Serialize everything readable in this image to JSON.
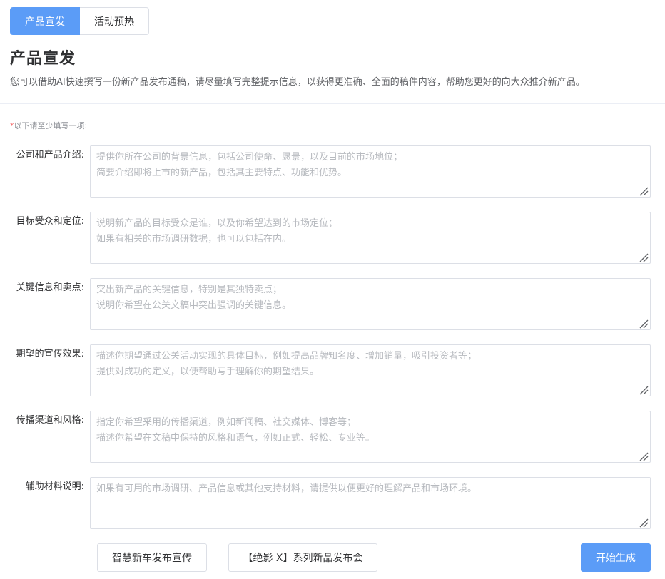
{
  "tabs": [
    {
      "label": "产品宣发",
      "active": true
    },
    {
      "label": "活动预热",
      "active": false
    }
  ],
  "header": {
    "title": "产品宣发",
    "description": "您可以借助AI快速撰写一份新产品发布通稿，请尽量填写完整提示信息，以获得更准确、全面的稿件内容，帮助您更好的向大众推介新产品。"
  },
  "form": {
    "required_mark": "*",
    "hint": "以下请至少填写一项:",
    "fields": [
      {
        "label": "公司和产品介绍:",
        "value": "",
        "placeholder": "提供你所在公司的背景信息，包括公司使命、愿景，以及目前的市场地位；\n简要介绍即将上市的新产品，包括其主要特点、功能和优势。"
      },
      {
        "label": "目标受众和定位:",
        "value": "",
        "placeholder": "说明新产品的目标受众是谁，以及你希望达到的市场定位；\n如果有相关的市场调研数据，也可以包括在内。"
      },
      {
        "label": "关键信息和卖点:",
        "value": "",
        "placeholder": "突出新产品的关键信息，特别是其独特卖点；\n说明你希望在公关文稿中突出强调的关键信息。"
      },
      {
        "label": "期望的宣传效果:",
        "value": "",
        "placeholder": "描述你期望通过公关活动实现的具体目标，例如提高品牌知名度、增加销量，吸引投资者等；\n提供对成功的定义，以便帮助写手理解你的期望结果。"
      },
      {
        "label": "传播渠道和风格:",
        "value": "",
        "placeholder": "指定你希望采用的传播渠道，例如新闻稿、社交媒体、博客等；\n描述你希望在文稿中保持的风格和语气，例如正式、轻松、专业等。"
      },
      {
        "label": "辅助材料说明:",
        "value": "",
        "placeholder": "如果有可用的市场调研、产品信息或其他支持材料，请提供以便更好的理解产品和市场环境。"
      }
    ]
  },
  "examples": [
    {
      "label": "智慧新车发布宣传"
    },
    {
      "label": "【绝影 X】系列新品发布会"
    }
  ],
  "actions": {
    "generate_label": "开始生成"
  },
  "colors": {
    "primary": "#5b9cf7",
    "required": "#f56c6c",
    "border": "#dcdfe6"
  }
}
